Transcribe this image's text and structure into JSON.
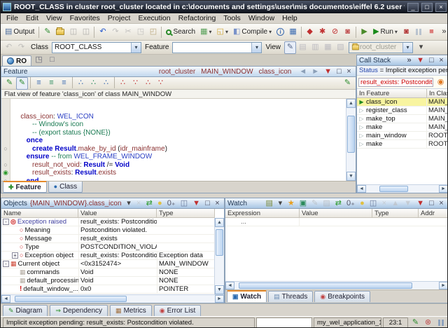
{
  "glyphs": {
    "up": "▲",
    "down": "▼",
    "left": "◄",
    "right": "►",
    "dropdown": "▾",
    "overflow": "»",
    "minimize": "_",
    "maximize": "□",
    "close": "×",
    "pin": "▼",
    "breakpoint": "○",
    "current_line": "◉",
    "stack_arrow": "▷",
    "current_arrow": "▶"
  },
  "colors": {
    "keyword": "#0000c8",
    "class_name": "#2b3fc4",
    "feature_name": "#8a3030",
    "comment": "#1a7a52",
    "error": "#cc0000",
    "accent_orange": "#e68b2c",
    "selection_yellow": "#f8f4a0",
    "panel_header_blue": "#a9c6e4"
  },
  "window": {
    "title": "ROOT_CLASS  in cluster root_cluster  located in c:\\documents and settings\\user\\mis documentos\\eiffel 6.2 user files\\proje..."
  },
  "menu": [
    "File",
    "Edit",
    "View",
    "Favorites",
    "Project",
    "Execution",
    "Refactoring",
    "Tools",
    "Window",
    "Help"
  ],
  "toolbar_main": {
    "items": [
      {
        "name": "output-toggle-button",
        "glyph": "▤",
        "color": "#4a6a9a",
        "label": "Output"
      },
      {
        "sep": true
      },
      {
        "name": "new-document-icon",
        "glyph": "✎",
        "color": "#2e8b2e"
      },
      {
        "name": "open-file-icon",
        "kind": "folder"
      },
      {
        "name": "save-icon",
        "glyph": "◫",
        "color": "#777",
        "disabled": true
      },
      {
        "name": "save-all-icon",
        "glyph": "◫",
        "color": "#777",
        "disabled": true
      },
      {
        "sep": true
      },
      {
        "name": "undo-icon",
        "glyph": "↶",
        "color": "#2255cc"
      },
      {
        "name": "redo-icon",
        "glyph": "↷",
        "color": "#999",
        "disabled": true
      },
      {
        "name": "cut-icon",
        "glyph": "✂",
        "color": "#999",
        "disabled": true
      },
      {
        "name": "copy-icon",
        "glyph": "◳",
        "color": "#999",
        "disabled": true
      },
      {
        "name": "paste-icon",
        "glyph": "◰",
        "color": "#b9a67a"
      },
      {
        "sep": true
      },
      {
        "name": "search-button",
        "kind": "mag",
        "label": "Search"
      },
      {
        "name": "diagram-tool-icon",
        "glyph": "▦",
        "color": "#58a058",
        "dropdown": true
      },
      {
        "name": "new-window-icon",
        "glyph": "◱",
        "color": "#d0a83a",
        "dropdown": true
      },
      {
        "name": "compile-button",
        "glyph": "◧",
        "color": "#7a93c9",
        "label": "Compile",
        "dropdown": true
      },
      {
        "name": "info-icon",
        "glyph": "i",
        "color": "#3a6ab0",
        "circle": true
      },
      {
        "name": "project-settings-icon",
        "glyph": "▦",
        "color": "#3a6ab0"
      },
      {
        "sep": true
      },
      {
        "name": "melt-icon",
        "glyph": "◆",
        "color": "#c03030"
      },
      {
        "name": "freeze-icon",
        "glyph": "✱",
        "color": "#c03030"
      },
      {
        "name": "finalize-icon",
        "glyph": "⊘",
        "color": "#c03030"
      },
      {
        "name": "precompile-icon",
        "glyph": "◙",
        "color": "#c05050"
      },
      {
        "sep": true
      },
      {
        "name": "debug-run-icon",
        "glyph": "▶",
        "color": "#4a8a2a"
      },
      {
        "name": "run-button",
        "glyph": "▶",
        "color": "#1a8a1a",
        "label": "Run",
        "dropdown": true
      },
      {
        "name": "attach-debugger-icon",
        "glyph": "◙",
        "color": "#b03030"
      },
      {
        "name": "pause-icon",
        "kind": "pause",
        "disabled": true
      },
      {
        "name": "stop-icon",
        "glyph": "■",
        "color": "#cc2222",
        "disabled": true
      },
      {
        "name": "toolbar-overflow-chevron",
        "glyph": "»",
        "color": "#333"
      }
    ]
  },
  "toolbar_context": {
    "nav_icons": [
      {
        "name": "history-back-icon",
        "glyph": "↶",
        "color": "#999",
        "disabled": true
      },
      {
        "name": "history-forward-icon",
        "glyph": "↷",
        "color": "#999",
        "disabled": true
      }
    ],
    "class_label": "Class",
    "class_value": "ROOT_CLASS",
    "feature_label": "Feature",
    "feature_value": "",
    "view_label": "View",
    "view_icons": [
      {
        "name": "view-editor-icon",
        "glyph": "✎",
        "color": "#556688",
        "pressed": true
      },
      {
        "name": "view-formatted-icon",
        "glyph": "▤",
        "color": "#99a",
        "disabled": true
      },
      {
        "name": "view-flat-icon",
        "glyph": "▥",
        "color": "#99a",
        "disabled": true
      },
      {
        "name": "view-contract-icon",
        "glyph": "▦",
        "color": "#99a",
        "disabled": true
      },
      {
        "name": "view-interface-icon",
        "glyph": "▧",
        "color": "#99a",
        "disabled": true
      }
    ],
    "cluster_value": "root_cluster",
    "more_icons": [
      {
        "name": "toolbar2-overflow-icon",
        "glyph": "▾",
        "color": "#444"
      }
    ]
  },
  "doc_tab": {
    "label": "RO"
  },
  "tabrow_icons": [
    {
      "name": "float-editor-icon",
      "glyph": "◳",
      "color": "#667"
    },
    {
      "name": "maximize-editor-icon",
      "glyph": "□",
      "color": "#667"
    }
  ],
  "feature_pane": {
    "title": "Feature",
    "breadcrumb": [
      "root_cluster",
      "MAIN_WINDOW",
      "class_icon"
    ],
    "header_icons": [
      {
        "name": "history-back-icon",
        "glyph": "◄",
        "color": "#8ca0b8"
      },
      {
        "name": "history-forward-icon",
        "glyph": "►",
        "color": "#8ca0b8"
      },
      {
        "name": "pin-icon",
        "glyph": "▼",
        "color": "#c03030"
      },
      {
        "name": "maximize-icon",
        "glyph": "□",
        "color": "#445"
      },
      {
        "name": "close-icon",
        "glyph": "×",
        "color": "#445"
      }
    ],
    "toolbar_icons": [
      {
        "name": "edit-class-icon",
        "glyph": "✎",
        "color": "#2a8a2a"
      },
      {
        "name": "edit-feature-icon",
        "glyph": "✎",
        "color": "#2a8a2a",
        "pressed": true
      },
      {
        "sep": true
      },
      {
        "name": "basic-text-view-icon",
        "glyph": "≡",
        "color": "#3a6ab0"
      },
      {
        "name": "clickable-view-icon",
        "glyph": "≡",
        "color": "#2a8a5a"
      },
      {
        "name": "assembly-view-icon",
        "glyph": "≡",
        "color": "#3a6ab0"
      },
      {
        "sep": true
      },
      {
        "name": "callers-icon",
        "glyph": "∴",
        "color": "#3a6ab0"
      },
      {
        "name": "callees-icon",
        "glyph": "∴",
        "color": "#2a8a5a"
      },
      {
        "name": "implementers-icon",
        "glyph": "∴",
        "color": "#3a6ab0"
      },
      {
        "sep": true
      },
      {
        "name": "ancestors-icon",
        "glyph": "∴",
        "color": "#c03030"
      },
      {
        "name": "descendants-icon",
        "glyph": "∵",
        "color": "#c03030"
      },
      {
        "name": "clients-icon",
        "glyph": "∴",
        "color": "#c03030"
      },
      {
        "name": "suppliers-icon",
        "glyph": "∵",
        "color": "#c03030"
      }
    ],
    "toolbar_right_icon": {
      "name": "open-in-editor-icon",
      "glyph": "✎",
      "color": "#2a8a2a"
    },
    "info": "Flat view of feature 'class_icon' of class MAIN_WINDOW",
    "code": [
      [],
      [
        [
          "f",
          "   class_icon"
        ],
        [
          "p",
          ": "
        ],
        [
          "c",
          "WEL_ICON"
        ]
      ],
      [
        [
          "m",
          "         -- Window's icon"
        ]
      ],
      [
        [
          "m",
          "         -- (export status {NONE})"
        ]
      ],
      [
        [
          "k",
          "      once"
        ]
      ],
      [
        [
          "p",
          "         "
        ],
        [
          "k",
          "create"
        ],
        [
          "p",
          " "
        ],
        [
          "b",
          "Result"
        ],
        [
          "p",
          "."
        ],
        [
          "f",
          "make_by_id"
        ],
        [
          "p",
          " ("
        ],
        [
          "f",
          "idr_mainframe"
        ],
        [
          "p",
          ")"
        ]
      ],
      [
        [
          "k",
          "      ensure"
        ],
        [
          "m",
          " -- from "
        ],
        [
          "c",
          "WEL_FRAME_WINDOW"
        ]
      ],
      [
        [
          "f",
          "         result_not_void"
        ],
        [
          "p",
          ": "
        ],
        [
          "b",
          "Result"
        ],
        [
          "p",
          " /= "
        ],
        [
          "b",
          "Void"
        ]
      ],
      [
        [
          "f",
          "         result_exists"
        ],
        [
          "p",
          ": "
        ],
        [
          "b",
          "Result"
        ],
        [
          "p",
          "."
        ],
        [
          "f",
          "exists"
        ]
      ],
      [
        [
          "k",
          "      end"
        ]
      ]
    ],
    "gutter": [
      "",
      "",
      "",
      "",
      "",
      "circle",
      "",
      "circle",
      "current",
      "circle"
    ],
    "tabs": [
      {
        "label": "Feature",
        "glyph": "✚",
        "color": "#2a8a2a",
        "active": true
      },
      {
        "label": "Class",
        "glyph": "●",
        "color": "#2a6ab0"
      }
    ]
  },
  "call_stack": {
    "title": "Call Stack",
    "header_icons": [
      {
        "name": "overflow-chevron-icon",
        "glyph": "»",
        "color": "#223"
      },
      {
        "name": "pin-icon",
        "glyph": "▼",
        "color": "#c03030"
      },
      {
        "name": "maximize-icon",
        "glyph": "□",
        "color": "#445"
      },
      {
        "name": "close-icon",
        "glyph": "×",
        "color": "#445"
      }
    ],
    "status_label": "Status",
    "status_text": " = Implicit exception pending",
    "error_text": "result_exists: Postcondition vi",
    "error_icon": {
      "name": "exception-dialog-icon",
      "glyph": "◉",
      "color": "#e07820"
    },
    "columns": [
      "In Feature",
      "In Class"
    ],
    "rows": [
      {
        "feature": "class_icon",
        "klass": "MAIN_WINDOW",
        "current": true
      },
      {
        "feature": "register_class",
        "klass": "MAIN_WINDOW"
      },
      {
        "feature": "make_top",
        "klass": "MAIN_WINDOW"
      },
      {
        "feature": "make",
        "klass": "MAIN_WINDOW"
      },
      {
        "feature": "main_window",
        "klass": "ROOT_CLASS"
      },
      {
        "feature": "make",
        "klass": "ROOT_CLASS"
      }
    ]
  },
  "objects": {
    "title": "Objects",
    "context": "{MAIN_WINDOW}.class_icon",
    "header_icons": [
      {
        "name": "dropdown-icon",
        "glyph": "▾",
        "color": "#444"
      },
      {
        "name": "delete-icon",
        "glyph": "×",
        "color": "#bbb",
        "disabled": true
      },
      {
        "name": "refresh-icon",
        "glyph": "⇄",
        "color": "#2a9a2a"
      },
      {
        "name": "bubble-icon",
        "glyph": "●",
        "color": "#e0c040"
      },
      {
        "name": "hex-format-icon",
        "glyph": "0₊",
        "color": "#556"
      },
      {
        "name": "save-icon",
        "glyph": "◫",
        "color": "#6a7a9a"
      },
      {
        "name": "pin-icon",
        "glyph": "▼",
        "color": "#c03030"
      },
      {
        "name": "maximize-icon",
        "glyph": "□",
        "color": "#445"
      },
      {
        "name": "close-icon",
        "glyph": "×",
        "color": "#445"
      }
    ],
    "columns": [
      "Name",
      "Value",
      "Type"
    ],
    "rows": [
      {
        "level": 0,
        "expand": "-",
        "icon": "exception",
        "name": "Exception raised",
        "link": true,
        "value": "result_exists: Postcondition vi...",
        "type": ""
      },
      {
        "level": 1,
        "expand": "",
        "icon": "dot",
        "name": "Meaning",
        "value": "Postcondition violated.",
        "type": ""
      },
      {
        "level": 1,
        "expand": "",
        "icon": "dot",
        "name": "Message",
        "value": "result_exists",
        "type": ""
      },
      {
        "level": 1,
        "expand": "",
        "icon": "dot",
        "name": "Type",
        "value": "POSTCONDITION_VIOLATI...",
        "type": ""
      },
      {
        "level": 1,
        "expand": "+",
        "icon": "dot",
        "name": "Exception object",
        "value": "result_exists: Postcondition vi...",
        "type": "Exception data"
      },
      {
        "level": 0,
        "expand": "-",
        "icon": "grid-red",
        "name": "Current object",
        "value": "<0x3152474>",
        "type": "MAIN_WINDOW"
      },
      {
        "level": 1,
        "expand": "",
        "icon": "grid",
        "name": "commands",
        "value": "Void",
        "type": "NONE"
      },
      {
        "level": 1,
        "expand": "",
        "icon": "grid",
        "name": "default_processin...",
        "value": "Void",
        "type": "NONE"
      },
      {
        "level": 1,
        "expand": "",
        "icon": "bang",
        "name": "default_window_...",
        "value": "0x0",
        "type": "POINTER"
      }
    ]
  },
  "watch": {
    "title": "Watch",
    "header_icons": [
      {
        "name": "new-expression-icon",
        "glyph": "▤",
        "color": "#7a8a3a"
      },
      {
        "name": "dropdown-icon",
        "glyph": "▾",
        "color": "#444"
      },
      {
        "name": "favorites-icon",
        "glyph": "★",
        "color": "#e8a020"
      },
      {
        "name": "edit-expression-icon",
        "glyph": "▣",
        "color": "#2a8a5a"
      },
      {
        "name": "modify-icon",
        "glyph": "✎",
        "color": "#aaa",
        "disabled": true
      },
      {
        "name": "edit-object-icon",
        "glyph": "▨",
        "color": "#aaa",
        "disabled": true
      },
      {
        "name": "refresh-icon",
        "glyph": "⇄",
        "color": "#2a9a2a"
      },
      {
        "name": "hex-format-icon",
        "glyph": "0₊",
        "color": "#556"
      },
      {
        "name": "bubble-icon",
        "glyph": "●",
        "color": "#e0c040"
      },
      {
        "name": "save-icon",
        "glyph": "◫",
        "color": "#6a7a9a"
      },
      {
        "name": "delete-icon",
        "glyph": "×",
        "color": "#bbb",
        "disabled": true
      },
      {
        "name": "move-up-icon",
        "glyph": "▲",
        "color": "#bbb",
        "disabled": true
      },
      {
        "name": "move-down-icon",
        "glyph": "▼",
        "color": "#bbb",
        "disabled": true
      },
      {
        "name": "pin-icon",
        "glyph": "▼",
        "color": "#c03030"
      },
      {
        "name": "maximize-icon",
        "glyph": "□",
        "color": "#445"
      },
      {
        "name": "close-icon",
        "glyph": "×",
        "color": "#445"
      }
    ],
    "columns": [
      "Expression",
      "Value",
      "Type",
      "Addr"
    ],
    "rows": [
      {
        "cells": [
          "...",
          "",
          "",
          ""
        ]
      }
    ],
    "tabs": [
      {
        "label": "Watch",
        "glyph": "▣",
        "color": "#2a6ab0",
        "active": true
      },
      {
        "label": "Threads",
        "glyph": "▤",
        "color": "#6a8ab0"
      },
      {
        "label": "Breakpoints",
        "glyph": "◉",
        "color": "#c04040"
      }
    ]
  },
  "bottom_tabs": [
    {
      "label": "Diagram",
      "glyph": "✎",
      "color": "#2a8a2a"
    },
    {
      "label": "Dependency",
      "glyph": "⇒",
      "color": "#1a8a1a"
    },
    {
      "label": "Metrics",
      "glyph": "▦",
      "color": "#a07040"
    },
    {
      "label": "Error List",
      "glyph": "◉",
      "color": "#c04040"
    }
  ],
  "status_bar": {
    "message": "Implicit exception pending: result_exists: Postcondition violated.",
    "input_value": "",
    "app_name": "my_wel_application_1",
    "caret_position": "23:1",
    "icons": [
      {
        "name": "edit-mode-icon",
        "glyph": "✎",
        "color": "#2a8a2a"
      },
      {
        "name": "compile-state-icon",
        "glyph": "⊗",
        "color": "#c05050"
      },
      {
        "name": "debugger-paused-icon",
        "kind": "pause"
      }
    ]
  }
}
